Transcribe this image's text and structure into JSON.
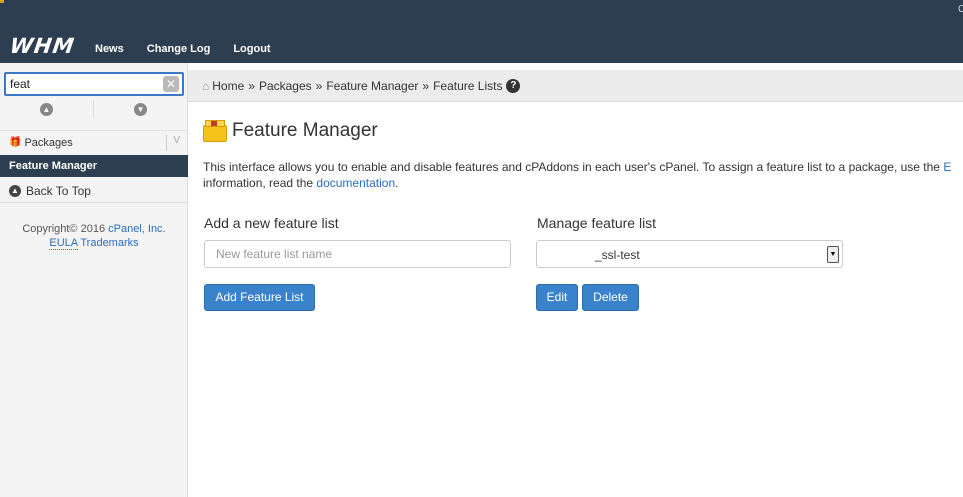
{
  "header": {
    "logo": "WHM",
    "nav": [
      "News",
      "Change Log",
      "Logout"
    ],
    "edge_text": "C"
  },
  "sidebar": {
    "search_value": "feat",
    "clear_glyph": "✕",
    "category": "Packages",
    "category_toggle": "V",
    "active_item": "Feature Manager",
    "back_to_top": "Back To Top",
    "copyright_prefix": "Copyright© 2016",
    "copyright_company": "cPanel, Inc.",
    "eula": "EULA",
    "trademarks": "Trademarks"
  },
  "breadcrumb": {
    "items": [
      "Home",
      "Packages",
      "Feature Manager",
      "Feature Lists"
    ],
    "separator": "»"
  },
  "main": {
    "title": "Feature Manager",
    "description_part1": "This interface allows you to enable and disable features and cPAddons in each user's cPanel. To assign a feature list to a package, use the ",
    "description_link1": "E",
    "description_part2": "information, read the ",
    "description_link2": "documentation",
    "description_part3": ".",
    "add_label": "Add a new feature list",
    "add_placeholder": "New feature list name",
    "add_button": "Add Feature List",
    "manage_label": "Manage feature list",
    "manage_selected": "_ssl-test",
    "edit_button": "Edit",
    "delete_button": "Delete"
  },
  "icons": {
    "home": "home-icon",
    "help": "help-icon",
    "package": "package-icon",
    "arrow_up": "arrow-up-icon",
    "arrow_down": "arrow-down-icon"
  },
  "colors": {
    "topbar": "#2c3e50",
    "accent": "#3a83cc",
    "link": "#2a6ebb"
  }
}
